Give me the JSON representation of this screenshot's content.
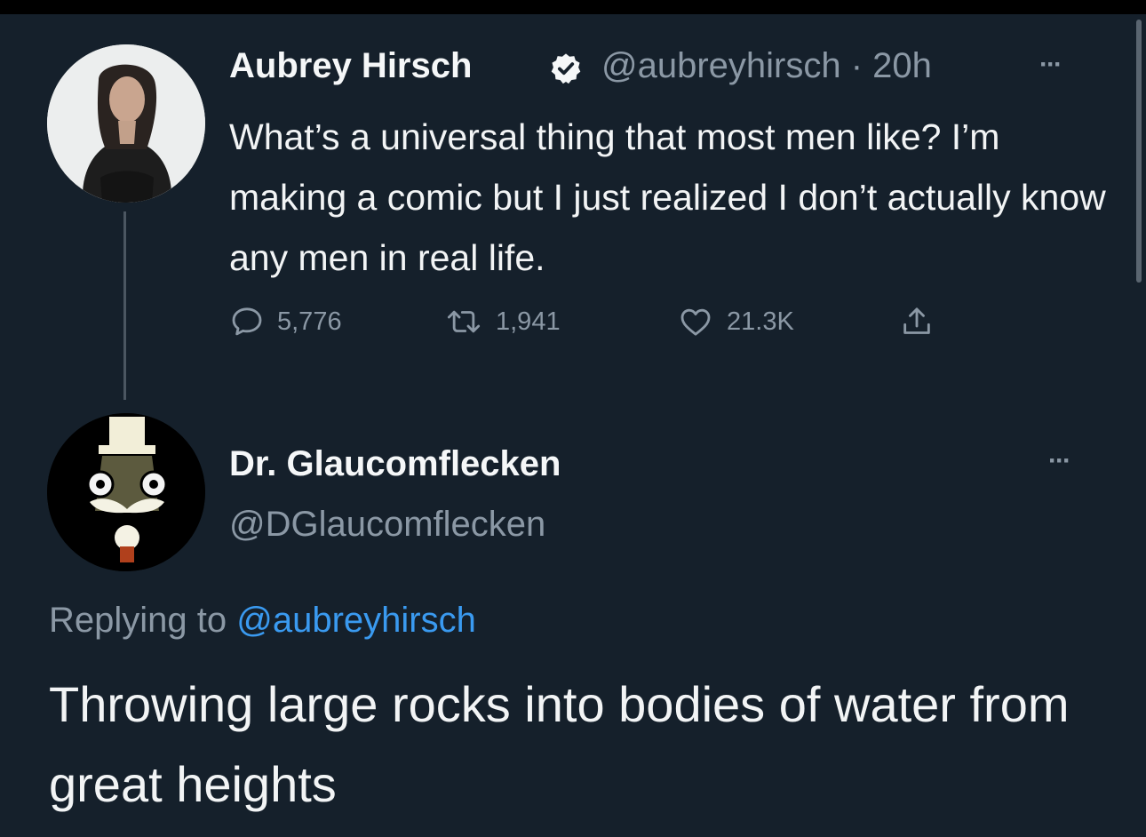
{
  "tweet": {
    "author_name": "Aubrey Hirsch",
    "author_handle": "@aubreyhirsch",
    "time": "20h",
    "handle_time": "@aubreyhirsch · 20h",
    "text": "What’s a universal thing that most men like? I’m making a comic but I just realized I don’t actually know any men in real life.",
    "replies": "5,776",
    "retweets": "1,941",
    "likes": "21.3K",
    "more": "···"
  },
  "reply": {
    "author_name": "Dr. Glaucomflecken",
    "author_handle": "@DGlaucomflecken",
    "replying_prefix": "Replying to",
    "replying_to": "@aubreyhirsch",
    "text": "Throwing large rocks into bodies of water from great heights",
    "more": "···"
  },
  "icons": {
    "verified": "verified-badge-icon",
    "reply": "reply-icon",
    "retweet": "retweet-icon",
    "like": "like-icon",
    "share": "share-icon"
  },
  "colors": {
    "background": "#15202b",
    "text": "#f2f4f5",
    "muted": "#8b98a5",
    "link": "#3a9af0"
  }
}
